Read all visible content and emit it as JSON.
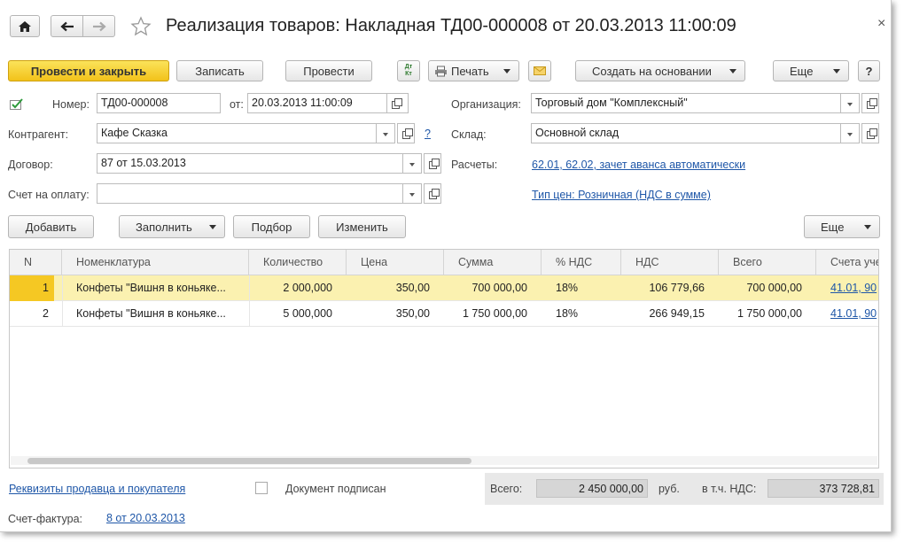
{
  "window": {
    "title": "Реализация товаров: Накладная ТД00-000008 от 20.03.2013 11:00:09",
    "close_symbol": "×"
  },
  "toolbar": {
    "post_close": "Провести и закрыть",
    "save": "Записать",
    "post": "Провести",
    "dtkt_label": "Дт Кт",
    "print": "Печать",
    "create_based": "Создать на основании",
    "more": "Еще",
    "help": "?"
  },
  "header": {
    "number_label": "Номер:",
    "number_value": "ТД00-000008",
    "date_label": "от:",
    "date_value": "20.03.2013 11:00:09",
    "org_label": "Организация:",
    "org_value": "Торговый дом \"Комплексный\"",
    "contractor_label": "Контрагент:",
    "contractor_value": "Кафе Сказка",
    "contractor_help": "?",
    "warehouse_label": "Склад:",
    "warehouse_value": "Основной склад",
    "contract_label": "Договор:",
    "contract_value": "87 от 15.03.2013",
    "settlements_label": "Расчеты:",
    "settlements_link": "62.01, 62.02, зачет аванса автоматически",
    "invoice_label": "Счет на оплату:",
    "invoice_value": "",
    "price_type_link": "Тип цен: Розничная (НДС в сумме)"
  },
  "table_toolbar": {
    "add": "Добавить",
    "fill": "Заполнить",
    "select": "Подбор",
    "change": "Изменить",
    "more": "Еще"
  },
  "table": {
    "columns": [
      "N",
      "Номенклатура",
      "Количество",
      "Цена",
      "Сумма",
      "% НДС",
      "НДС",
      "Всего",
      "Счета уче"
    ],
    "rows": [
      [
        "1",
        "Конфеты \"Вишня в коньяке...",
        "2 000,000",
        "350,00",
        "700 000,00",
        "18%",
        "106 779,66",
        "700 000,00",
        "41.01, 90"
      ],
      [
        "2",
        "Конфеты \"Вишня в коньяке...",
        "5 000,000",
        "350,00",
        "1 750 000,00",
        "18%",
        "266 949,15",
        "1 750 000,00",
        "41.01, 90"
      ]
    ],
    "selected_row": 1
  },
  "footer": {
    "requisites_link": "Реквизиты продавца и покупателя",
    "signed_label": "Документ подписан",
    "signed_checked": false,
    "total_label": "Всего:",
    "total_value": "2 450 000,00",
    "currency": "руб.",
    "vat_label": "в т.ч. НДС:",
    "vat_value": "373 728,81",
    "invoice_label": "Счет-фактура:",
    "invoice_link": "8 от 20.03.2013"
  },
  "colors": {
    "primary_button": "#f5c823",
    "selected_row": "#fbf1b0",
    "link": "#1f57a8"
  }
}
